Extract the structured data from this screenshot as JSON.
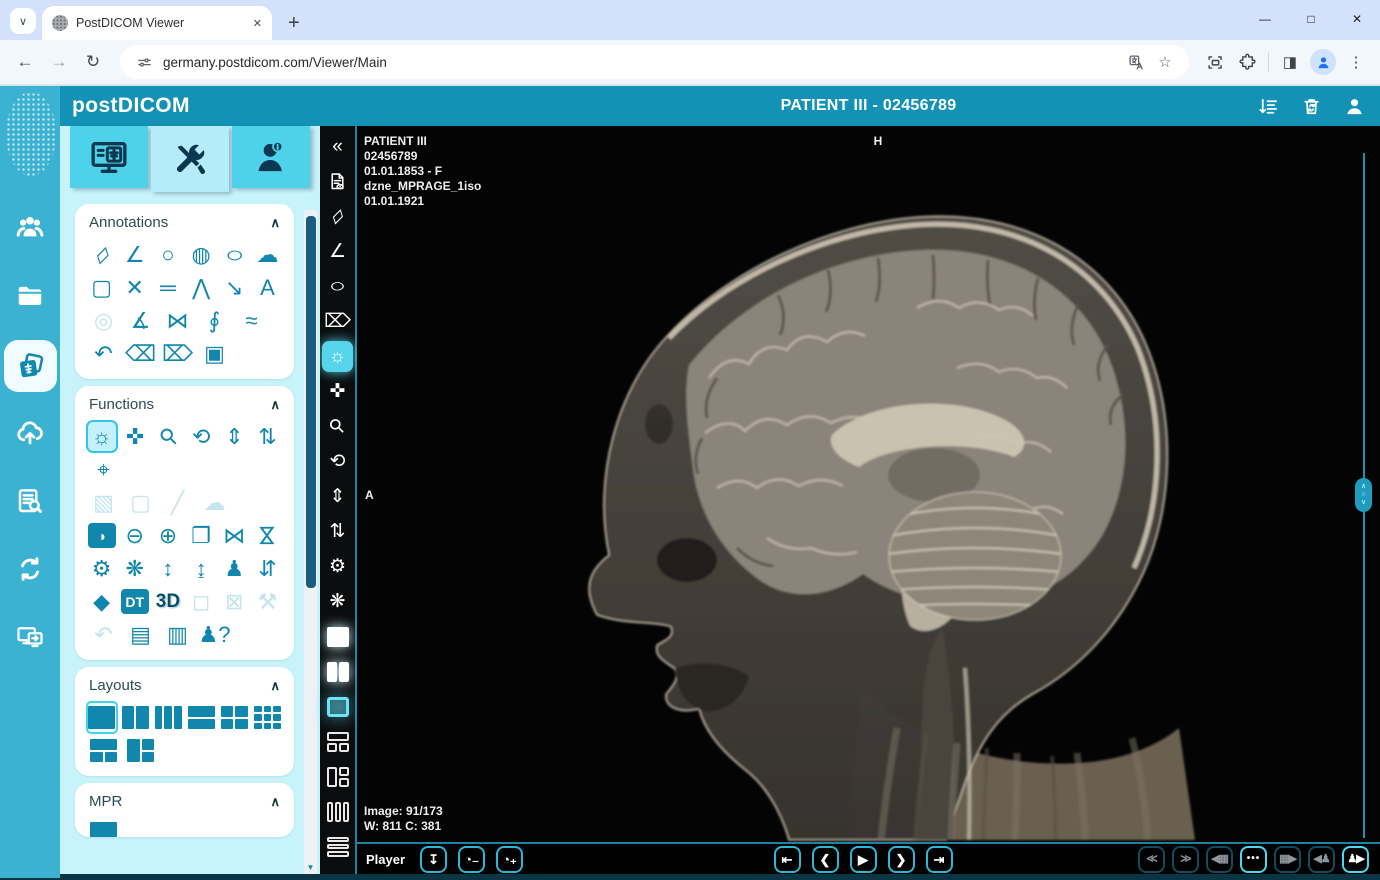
{
  "browser": {
    "tab": {
      "title": "PostDICOM Viewer"
    },
    "url": "germany.postdicom.com/Viewer/Main",
    "new_tab": "+",
    "nav_icons": [
      "back",
      "forward",
      "reload"
    ],
    "url_left_icon": "site-settings",
    "url_right_icons": [
      "translate",
      "bookmark-star"
    ],
    "toolbar_icons": [
      "capture",
      "extensions",
      "side-panel",
      "profile",
      "kebab-menu"
    ],
    "window_controls": [
      "window-minimize",
      "window-maximize",
      "window-close"
    ]
  },
  "header": {
    "logo": "postDICOM",
    "title": "PATIENT III - 02456789",
    "right_icons": [
      "sort-list",
      "trash",
      "user"
    ]
  },
  "sidebar": {
    "items": [
      {
        "name": "patients"
      },
      {
        "name": "folders"
      },
      {
        "name": "studies",
        "state": "active"
      },
      {
        "name": "upload"
      },
      {
        "name": "query"
      },
      {
        "name": "transfer"
      },
      {
        "name": "share"
      }
    ]
  },
  "tabs": [
    {
      "name": "viewer"
    },
    {
      "name": "tools",
      "state": "active"
    },
    {
      "name": "patient-info"
    }
  ],
  "panel": {
    "sections": [
      {
        "title": "Annotations",
        "rows": [
          [
            {
              "name": "ruler"
            },
            {
              "name": "angle"
            },
            {
              "name": "circle"
            },
            {
              "name": "filled-ellipse"
            },
            {
              "name": "ellipse"
            },
            {
              "name": "freehand"
            }
          ],
          [
            {
              "name": "rect-roi"
            },
            {
              "name": "cross-lines"
            },
            {
              "name": "parallel-lines"
            },
            {
              "name": "polyline"
            },
            {
              "name": "arrow"
            },
            {
              "name": "text"
            }
          ],
          [
            {
              "name": "target",
              "state": "disabled"
            },
            {
              "name": "angle-2line"
            },
            {
              "name": "cobb-angle"
            },
            {
              "name": "region"
            },
            {
              "name": "wave"
            }
          ],
          [
            {
              "name": "undo"
            },
            {
              "name": "eraser"
            },
            {
              "name": "eraser-all"
            },
            {
              "name": "save-annotation"
            }
          ]
        ]
      },
      {
        "title": "Functions",
        "rows": [
          [
            {
              "name": "window-level",
              "state": "active"
            },
            {
              "name": "pan"
            },
            {
              "name": "magnify"
            },
            {
              "name": "rotate"
            },
            {
              "name": "scroll-vertical"
            },
            {
              "name": "stack-scroll"
            }
          ],
          [
            {
              "name": "crosshair"
            }
          ],
          [
            {
              "name": "wl-region",
              "state": "disabled"
            },
            {
              "name": "select-region",
              "state": "disabled"
            },
            {
              "name": "probe",
              "state": "disabled"
            },
            {
              "name": "freehand-select",
              "state": "disabled"
            }
          ],
          [
            {
              "name": "invert",
              "state": "chip"
            },
            {
              "name": "zoom-out"
            },
            {
              "name": "zoom-in"
            },
            {
              "name": "flip"
            },
            {
              "name": "mirror-h"
            },
            {
              "name": "mirror-v"
            }
          ],
          [
            {
              "name": "reset"
            },
            {
              "name": "reset-wl"
            },
            {
              "name": "expand-v"
            },
            {
              "name": "collapse-v"
            },
            {
              "name": "orientation"
            },
            {
              "name": "sort-images"
            }
          ],
          [
            {
              "name": "tag"
            },
            {
              "name": "dt-report",
              "state": "chip"
            },
            {
              "name": "three-d"
            },
            {
              "name": "resize-box",
              "state": "disabled"
            },
            {
              "name": "crop",
              "state": "disabled"
            },
            {
              "name": "adjust",
              "state": "disabled"
            }
          ],
          [
            {
              "name": "undo-state",
              "state": "disabled"
            },
            {
              "name": "export-image"
            },
            {
              "name": "save-image"
            },
            {
              "name": "person-help"
            }
          ]
        ]
      },
      {
        "title": "Layouts",
        "rows": [
          [
            {
              "name": "layout-1x1",
              "layout": "l11",
              "state": "layout-active"
            },
            {
              "name": "layout-1x2",
              "layout": "l12"
            },
            {
              "name": "layout-1x3",
              "layout": "l13"
            },
            {
              "name": "layout-2x1",
              "layout": "l21"
            },
            {
              "name": "layout-2x2",
              "layout": "l22"
            },
            {
              "name": "layout-3x3",
              "layout": "l33"
            }
          ],
          [
            {
              "name": "layout-1-2",
              "layout": "l1t2"
            },
            {
              "name": "layout-left-2",
              "layout": "llt2"
            }
          ]
        ]
      },
      {
        "title": "MPR",
        "rows": [
          [
            {
              "name": "mpr-layout",
              "layout": "l11"
            }
          ]
        ]
      }
    ]
  },
  "toolbar": {
    "items": [
      {
        "name": "collapse-panel"
      },
      {
        "name": "doc-view"
      },
      {
        "name": "ruler"
      },
      {
        "name": "angle"
      },
      {
        "name": "ellipse"
      },
      {
        "name": "eraser-all"
      },
      {
        "name": "window-level",
        "state": "active"
      },
      {
        "name": "pan"
      },
      {
        "name": "magnify"
      },
      {
        "name": "rotate"
      },
      {
        "name": "scroll-vertical"
      },
      {
        "name": "stack-scroll"
      },
      {
        "name": "reset"
      },
      {
        "name": "reset-wl"
      },
      {
        "name": "layout-1x1",
        "layout": "l11",
        "state": "on"
      },
      {
        "name": "layout-1x2",
        "layout": "l12",
        "state": "on"
      },
      {
        "name": "series-layout",
        "layout": "l11",
        "state": "hl"
      },
      {
        "name": "layout-1-2",
        "layout": "l1t2",
        "state": "outline"
      },
      {
        "name": "layout-left-2",
        "layout": "llt2",
        "state": "outline"
      },
      {
        "name": "layout-3col",
        "layout": "l13",
        "state": "outline"
      },
      {
        "name": "layout-3row",
        "layout": "l3row",
        "state": "outline"
      }
    ]
  },
  "viewport": {
    "overlay_top": [
      "PATIENT III",
      "02456789",
      "01.01.1853 - F",
      "dzne_MPRAGE_1iso",
      "01.01.1921"
    ],
    "marker_top": "H",
    "marker_left": "A",
    "overlay_bottom": [
      "Image: 91/173",
      "W: 811 C: 381"
    ]
  },
  "player": {
    "label": "Player",
    "left_buttons": [
      {
        "name": "download"
      },
      {
        "name": "speed-down"
      },
      {
        "name": "speed-up"
      }
    ],
    "transport": [
      {
        "name": "first-image"
      },
      {
        "name": "previous-image"
      },
      {
        "name": "play"
      },
      {
        "name": "next-image"
      },
      {
        "name": "last-image"
      }
    ],
    "right_buttons": [
      {
        "name": "fast-backward",
        "state": "disabled"
      },
      {
        "name": "fast-forward",
        "state": "disabled"
      },
      {
        "name": "prev-series",
        "state": "disabled"
      },
      {
        "name": "series-list",
        "state": "bright"
      },
      {
        "name": "next-series",
        "state": "disabled"
      },
      {
        "name": "prev-patient",
        "state": "disabled"
      },
      {
        "name": "next-patient",
        "state": "bright"
      }
    ]
  },
  "colors": {
    "accent": "#1392b5",
    "sidebar": "#3cb2d2",
    "tab_active": "#b4edf9",
    "panel_bg": "#c8f3fb",
    "icon_teal": "#0f86ad",
    "toolbar_active": "#56d4e9",
    "player_border": "#2bb7d6"
  }
}
